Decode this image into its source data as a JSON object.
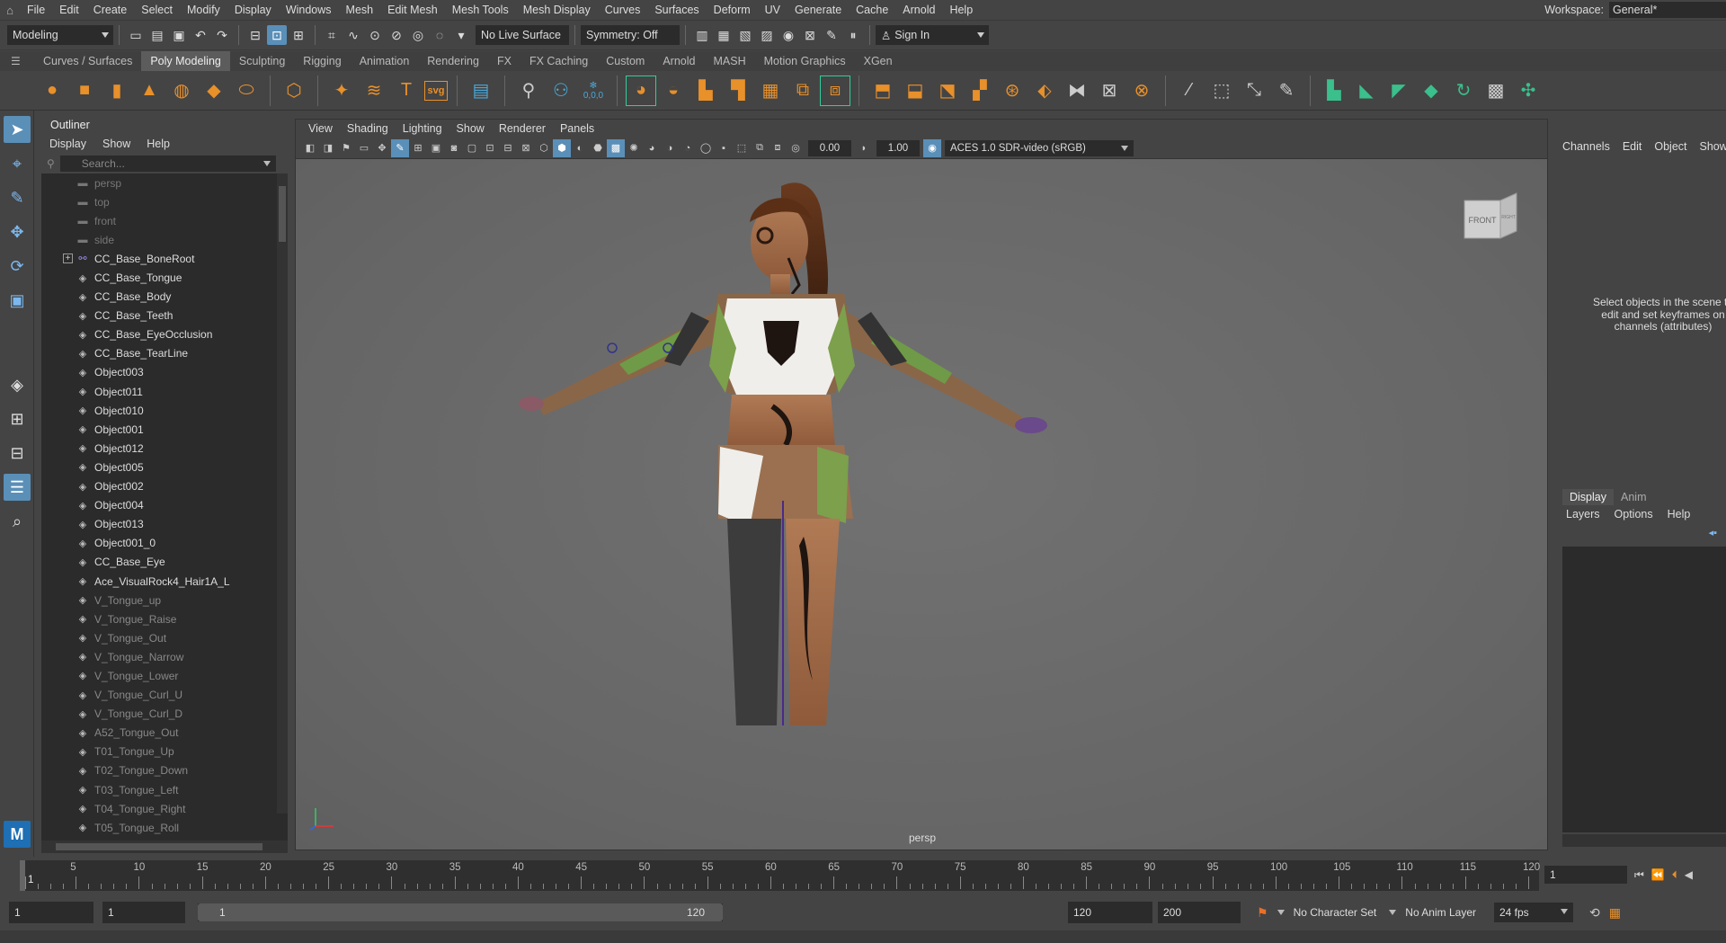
{
  "menubar": {
    "items": [
      "File",
      "Edit",
      "Create",
      "Select",
      "Modify",
      "Display",
      "Windows",
      "Mesh",
      "Edit Mesh",
      "Mesh Tools",
      "Mesh Display",
      "Curves",
      "Surfaces",
      "Deform",
      "UV",
      "Generate",
      "Cache",
      "Arnold",
      "Help"
    ],
    "workspace_label": "Workspace:",
    "workspace_value": "General*"
  },
  "statusline": {
    "menuset": "Modeling",
    "live_surface": "No Live Surface",
    "symmetry": "Symmetry: Off",
    "sign_in": "Sign In"
  },
  "shelf": {
    "tabs": [
      "Curves / Surfaces",
      "Poly Modeling",
      "Sculpting",
      "Rigging",
      "Animation",
      "Rendering",
      "FX",
      "FX Caching",
      "Custom",
      "Arnold",
      "MASH",
      "Motion Graphics",
      "XGen"
    ],
    "active_tab": "Poly Modeling",
    "text_tool_glyph": "T",
    "svg_tool_label": "svg",
    "coords_label": "0,0,0"
  },
  "outliner": {
    "title": "Outliner",
    "menu": [
      "Display",
      "Show",
      "Help"
    ],
    "search_placeholder": "Search...",
    "items": [
      {
        "label": "persp",
        "kind": "camera",
        "dim": true
      },
      {
        "label": "top",
        "kind": "camera",
        "dim": true
      },
      {
        "label": "front",
        "kind": "camera",
        "dim": true
      },
      {
        "label": "side",
        "kind": "camera",
        "dim": true
      },
      {
        "label": "CC_Base_BoneRoot",
        "kind": "joint",
        "dim": false,
        "expandable": true
      },
      {
        "label": "CC_Base_Tongue",
        "kind": "mesh",
        "dim": false
      },
      {
        "label": "CC_Base_Body",
        "kind": "mesh",
        "dim": false
      },
      {
        "label": "CC_Base_Teeth",
        "kind": "mesh",
        "dim": false
      },
      {
        "label": "CC_Base_EyeOcclusion",
        "kind": "mesh",
        "dim": false
      },
      {
        "label": "CC_Base_TearLine",
        "kind": "mesh",
        "dim": false
      },
      {
        "label": "Object003",
        "kind": "mesh",
        "dim": false
      },
      {
        "label": "Object011",
        "kind": "mesh",
        "dim": false
      },
      {
        "label": "Object010",
        "kind": "mesh",
        "dim": false
      },
      {
        "label": "Object001",
        "kind": "mesh",
        "dim": false
      },
      {
        "label": "Object012",
        "kind": "mesh",
        "dim": false
      },
      {
        "label": "Object005",
        "kind": "mesh",
        "dim": false
      },
      {
        "label": "Object002",
        "kind": "mesh",
        "dim": false
      },
      {
        "label": "Object004",
        "kind": "mesh",
        "dim": false
      },
      {
        "label": "Object013",
        "kind": "mesh",
        "dim": false
      },
      {
        "label": "Object001_0",
        "kind": "mesh",
        "dim": false
      },
      {
        "label": "CC_Base_Eye",
        "kind": "mesh",
        "dim": false
      },
      {
        "label": "Ace_VisualRock4_Hair1A_L",
        "kind": "mesh",
        "dim": false
      },
      {
        "label": "V_Tongue_up",
        "kind": "mesh",
        "dim": true
      },
      {
        "label": "V_Tongue_Raise",
        "kind": "mesh",
        "dim": true
      },
      {
        "label": "V_Tongue_Out",
        "kind": "mesh",
        "dim": true
      },
      {
        "label": "V_Tongue_Narrow",
        "kind": "mesh",
        "dim": true
      },
      {
        "label": "V_Tongue_Lower",
        "kind": "mesh",
        "dim": true
      },
      {
        "label": "V_Tongue_Curl_U",
        "kind": "mesh",
        "dim": true
      },
      {
        "label": "V_Tongue_Curl_D",
        "kind": "mesh",
        "dim": true
      },
      {
        "label": "A52_Tongue_Out",
        "kind": "mesh",
        "dim": true
      },
      {
        "label": "T01_Tongue_Up",
        "kind": "mesh",
        "dim": true
      },
      {
        "label": "T02_Tongue_Down",
        "kind": "mesh",
        "dim": true
      },
      {
        "label": "T03_Tongue_Left",
        "kind": "mesh",
        "dim": true
      },
      {
        "label": "T04_Tongue_Right",
        "kind": "mesh",
        "dim": true
      },
      {
        "label": "T05_Tongue_Roll",
        "kind": "mesh",
        "dim": true
      }
    ]
  },
  "viewport": {
    "menu": [
      "View",
      "Shading",
      "Lighting",
      "Show",
      "Renderer",
      "Panels"
    ],
    "exposure": "0.00",
    "gamma": "1.00",
    "color_space": "ACES 1.0 SDR-video (sRGB)",
    "camera": "persp",
    "viewcube_front": "FRONT",
    "viewcube_right": "RIGHT"
  },
  "channelbox": {
    "menu": [
      "Channels",
      "Edit",
      "Object",
      "Show"
    ],
    "message": "Select objects in the scene to edit and set keyframes on channels (attributes)"
  },
  "layers": {
    "tabs": [
      "Display",
      "Anim"
    ],
    "active_tab": "Display",
    "menu": [
      "Layers",
      "Options",
      "Help"
    ]
  },
  "timeslider": {
    "ticks": [
      1,
      5,
      10,
      15,
      20,
      25,
      30,
      35,
      40,
      45,
      50,
      55,
      60,
      65,
      70,
      75,
      80,
      85,
      90,
      95,
      100,
      105,
      110,
      115,
      120
    ],
    "current_frame": "1"
  },
  "range": {
    "start": "1",
    "anim_start": "1",
    "range_start": "1",
    "range_end": "120",
    "end": "120",
    "anim_end": "200",
    "character_set": "No Character Set",
    "anim_layer": "No Anim Layer",
    "fps": "24 fps"
  },
  "colors": {
    "accent": "#5a8fb8",
    "panel": "#444444",
    "field": "#2b2b2b",
    "viewport": "#6b6b6b",
    "shelf_orange": "#e8902a",
    "shelf_green": "#3bbf8c"
  }
}
